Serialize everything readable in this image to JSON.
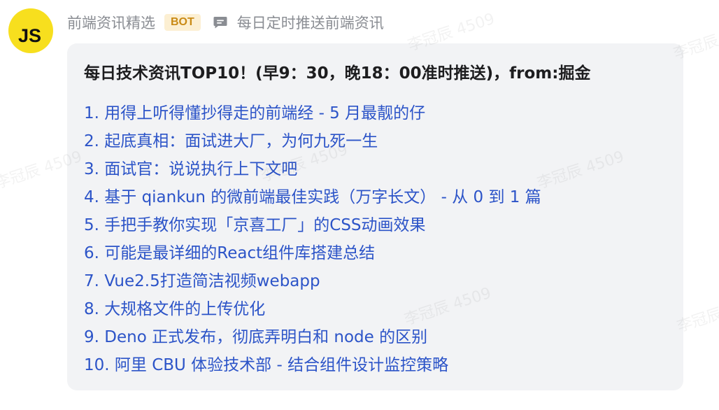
{
  "avatar": {
    "text": "JS",
    "color": "#f7df1e"
  },
  "header": {
    "sender_name": "前端资讯精选",
    "badge": "BOT",
    "channel_icon": "message-icon",
    "channel_desc": "每日定时推送前端资讯"
  },
  "message": {
    "title": "每日技术资讯TOP10！(早9：30，晚18：00准时推送)，from:掘金",
    "items": [
      "1. 用得上听得懂抄得走的前端经 - 5 月最靓的仔",
      "2. 起底真相：面试进大厂，为何九死一生",
      "3. 面试官：说说执行上下文吧",
      "4. 基于 qiankun 的微前端最佳实践（万字长文） - 从 0 到 1 篇",
      "5. 手把手教你实现「京喜工厂」的CSS动画效果",
      "6. 可能是最详细的React组件库搭建总结",
      "7. Vue2.5打造简洁视频webapp",
      "8. 大规格文件的上传优化",
      "9. Deno 正式发布，彻底弄明白和 node 的区别",
      "10. 阿里 CBU 体验技术部 - 结合组件设计监控策略"
    ]
  },
  "watermark": {
    "text": "李冠辰 4509"
  },
  "colors": {
    "bubble_bg": "#f2f3f5",
    "link": "#2c54c8",
    "badge_bg": "#fcefd2",
    "badge_text": "#c98a15",
    "muted": "#8a8d93"
  }
}
